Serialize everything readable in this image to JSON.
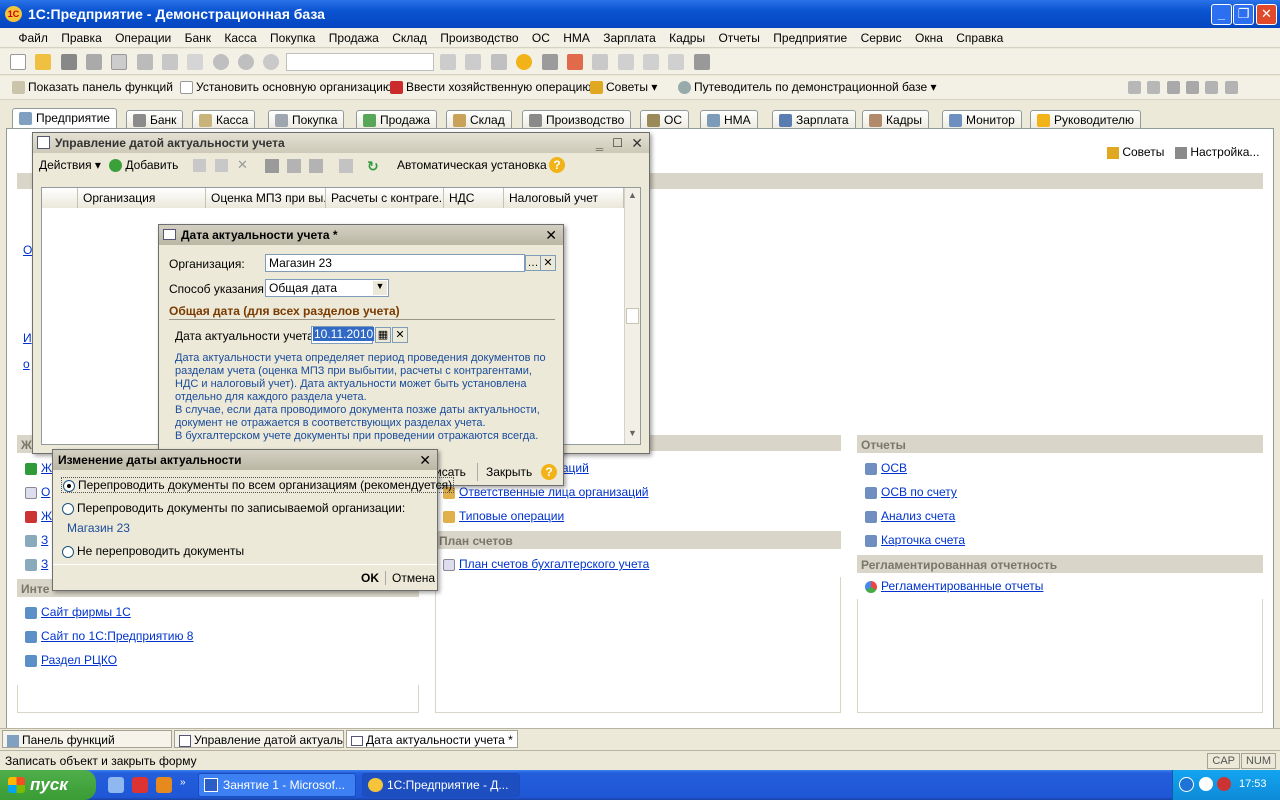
{
  "app": {
    "title": "1С:Предприятие - Демонстрационная база",
    "logo": "1С"
  },
  "menu": [
    "Файл",
    "Правка",
    "Операции",
    "Банк",
    "Касса",
    "Покупка",
    "Продажа",
    "Склад",
    "Производство",
    "ОС",
    "НМА",
    "Зарплата",
    "Кадры",
    "Отчеты",
    "Предприятие",
    "Сервис",
    "Окна",
    "Справка"
  ],
  "toolbar2": {
    "show_panel": "Показать панель функций",
    "set_org": "Установить основную организацию",
    "enter_op": "Ввести хозяйственную операцию",
    "tips": "Советы",
    "guide": "Путеводитель по демонстрационной базе"
  },
  "tabs": [
    "Предприятие",
    "Банк",
    "Касса",
    "Покупка",
    "Продажа",
    "Склад",
    "Производство",
    "ОС",
    "НМА",
    "Зарплата",
    "Кадры",
    "Монитор",
    "Руководителю"
  ],
  "right_panel": {
    "tips": "Советы",
    "settings": "Настройка..."
  },
  "sections": {
    "reports_head": "Отчеты",
    "reports": [
      "ОСВ",
      "ОСВ по счету",
      "Анализ счета",
      "Карточка счета"
    ],
    "reg_head": "Регламентированная отчетность",
    "reg": [
      "Регламентированные отчеты"
    ],
    "mid_links": [
      "Ответственные лица организаций",
      "Типовые операции"
    ],
    "mid_top_fragment": "низаций",
    "chart_head": "План счетов",
    "chart_links": [
      "План счетов бухгалтерского учета"
    ],
    "inet_head": "Инте",
    "inet_links": [
      "Сайт фирмы 1С",
      "Сайт по 1С:Предприятию 8",
      "Раздел РЦКО"
    ],
    "left_frag": [
      "О",
      "И",
      "о",
      "Ж",
      "Ж",
      "О",
      "Ж",
      "З",
      "З"
    ]
  },
  "mgr_window": {
    "title": "Управление датой актуальности учета",
    "actions": "Действия",
    "add": "Добавить",
    "auto": "Автоматическая установка",
    "columns": [
      "Организация",
      "Оценка МПЗ при вы...",
      "Расчеты с контраге...",
      "НДС",
      "Налоговый учет"
    ]
  },
  "date_window": {
    "title": "Дата актуальности учета *",
    "org_label": "Организация:",
    "org_value": "Магазин 23",
    "method_label": "Способ указания :",
    "method_value": "Общая дата",
    "group_title": "Общая дата (для всех разделов учета)",
    "date_label": "Дата актуальности учета:",
    "date_value": "10.11.2010",
    "info1": "Дата актуальности учета определяет период проведения документов по разделам учета (оценка МПЗ при выбытии, расчеты с контрагентами, НДС и налоговый учет). Дата актуальности может быть установлена отдельно для каждого раздела учета.",
    "info2": "В случае, если дата проводимого документа позже даты актуальности, документ не отражается в соответствующих разделах учета.",
    "info3": "В бухгалтерском учете документы при проведении отражаются всегда.",
    "btn_write": "исать",
    "btn_close": "Закрыть"
  },
  "change_dialog": {
    "title": "Изменение даты актуальности",
    "opt1": "Перепроводить документы по всем организациям (рекомендуется)",
    "opt2": "Перепроводить документы по записываемой организации:",
    "org": "Магазин 23",
    "opt3": "Не перепроводить документы",
    "ok": "OK",
    "cancel": "Отмена"
  },
  "window_tabs": [
    "Панель функций",
    "Управление датой актуаль...",
    "Дата актуальности учета *"
  ],
  "status": {
    "text": "Записать объект и закрыть форму",
    "cap": "CAP",
    "num": "NUM"
  },
  "taskbar": {
    "start": "пуск",
    "items": [
      "Занятие 1 - Microsof...",
      "1С:Предприятие - Д..."
    ],
    "lang": "RL",
    "time": "17:53"
  },
  "colors": {
    "accent": "#0a53d0",
    "link": "#0033cc",
    "info": "#1a4c9c",
    "section_head": "#d9d5c8"
  }
}
